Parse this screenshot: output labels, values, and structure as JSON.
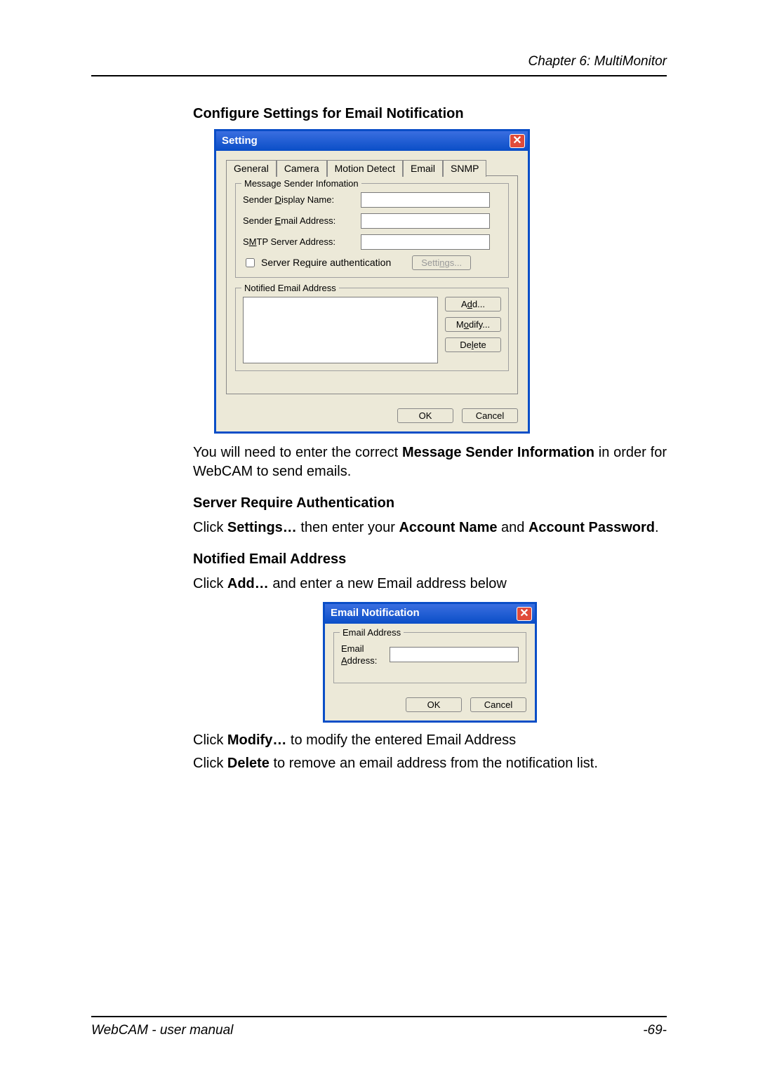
{
  "header": {
    "chapter": "Chapter 6: MultiMonitor"
  },
  "section1": {
    "title": "Configure Settings for Email Notification",
    "body_pre": "You will need to enter the correct ",
    "body_bold": "Message Sender Information",
    "body_post": " in order for WebCAM to send emails."
  },
  "dialog1": {
    "title": "Setting",
    "tabs": [
      "General",
      "Camera",
      "Motion Detect",
      "Email",
      "SNMP"
    ],
    "active_tab": "Email",
    "group_sender": {
      "legend": "Message Sender Infomation",
      "display_name_label": "Sender Display Name:",
      "email_label": "Sender Email Address:",
      "smtp_label": "SMTP Server Address:",
      "auth_checkbox": "Server Require authentication",
      "settings_btn": "Settings..."
    },
    "group_notified": {
      "legend": "Notified Email Address",
      "add_btn": "Add...",
      "modify_btn": "Modify...",
      "delete_btn": "Delete"
    },
    "ok": "OK",
    "cancel": "Cancel"
  },
  "section2": {
    "title": "Server Require Authentication",
    "p_pre": "Click ",
    "p_b1": "Settings…",
    "p_mid": " then enter your ",
    "p_b2": "Account Name",
    "p_and": " and ",
    "p_b3": "Account Password",
    "p_end": "."
  },
  "section3": {
    "title": "Notified Email Address",
    "p_pre": "Click ",
    "p_b1": "Add…",
    "p_post": " and enter a new Email address below"
  },
  "dialog2": {
    "title": "Email Notification",
    "group_legend": "Email Address",
    "label": "Email Address:",
    "ok": "OK",
    "cancel": "Cancel"
  },
  "section4": {
    "p1_pre": "Click ",
    "p1_b": "Modify…",
    "p1_post": " to modify the entered Email Address",
    "p2_pre": "Click ",
    "p2_b": "Delete",
    "p2_post": " to remove an email address from the notification list."
  },
  "footer": {
    "left": "WebCAM - user manual",
    "right": "-69-"
  }
}
